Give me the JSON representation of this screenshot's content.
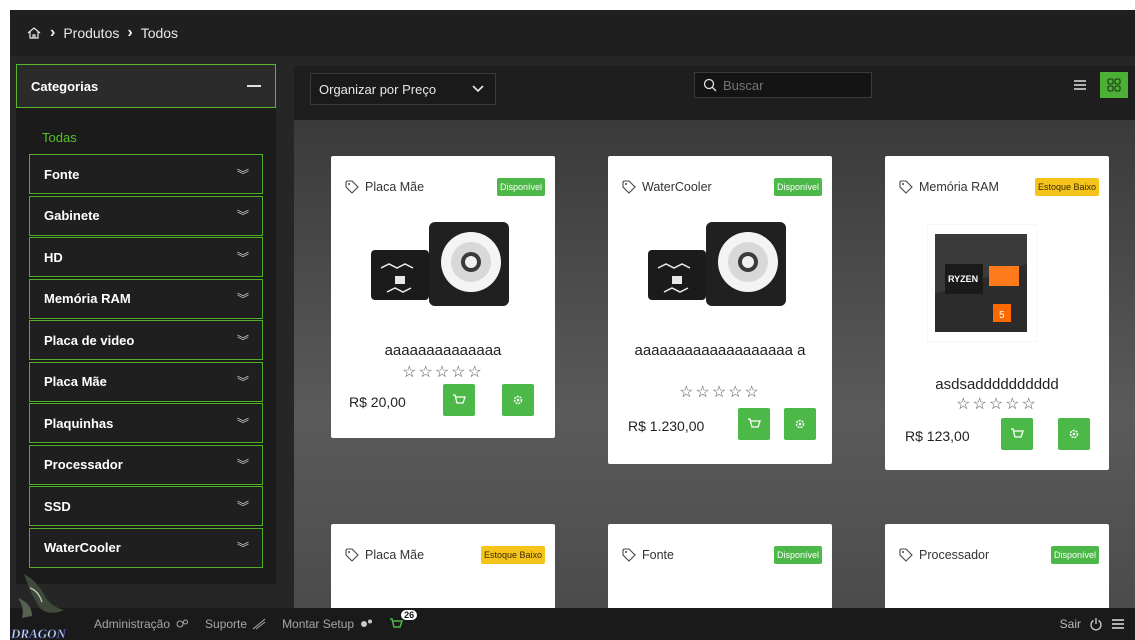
{
  "breadcrumb": {
    "home_icon": "home-icon",
    "items": [
      "Produtos",
      "Todos"
    ]
  },
  "sidebar": {
    "header": "Categorias",
    "all_label": "Todas",
    "categories": [
      "Fonte",
      "Gabinete",
      "HD",
      "Memória RAM",
      "Placa de video",
      "Placa Mãe",
      "Plaquinhas",
      "Processador",
      "SSD",
      "WaterCooler"
    ]
  },
  "toolbar": {
    "sort_label": "Organizar por Preço",
    "search_placeholder": "Buscar"
  },
  "products": [
    {
      "category": "Placa Mãe",
      "status": "Disponível",
      "status_type": "ok",
      "name": "aaaaaaaaaaaaaa",
      "price": "R$ 20,00",
      "image": "watercooler-image"
    },
    {
      "category": "WaterCooler",
      "status": "Disponível",
      "status_type": "ok",
      "name": "aaaaaaaaaaaaaaaaaaa a",
      "price": "R$ 1.230,00",
      "image": "watercooler-image"
    },
    {
      "category": "Memória RAM",
      "status": "Estoque Baixo",
      "status_type": "low",
      "name": "asdsadddddddddd",
      "price": "R$ 123,00",
      "image": "ryzen-cpu-box-image"
    },
    {
      "category": "Placa Mãe",
      "status": "Estoque Baixo",
      "status_type": "low"
    },
    {
      "category": "Fonte",
      "status": "Disponível",
      "status_type": "ok"
    },
    {
      "category": "Processador",
      "status": "Disponível",
      "status_type": "ok"
    }
  ],
  "bottom_nav": {
    "logo_text": "DRAGON",
    "items": [
      "Administração",
      "Suporte",
      "Montar Setup"
    ],
    "cart_count": "26",
    "logout": "Sair"
  },
  "colors": {
    "accent": "#4cb848",
    "warning": "#f6c31a",
    "background": "#262626"
  }
}
